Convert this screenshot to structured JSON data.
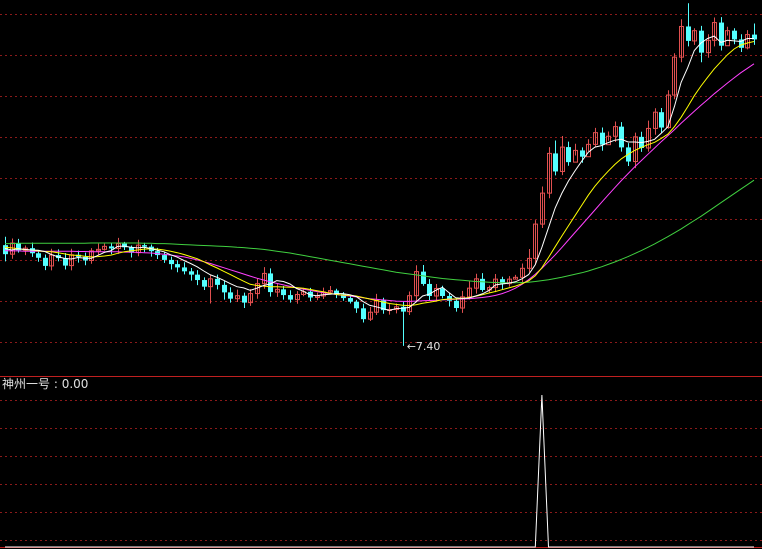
{
  "indicator": {
    "name": "神州一号",
    "separator": " : ",
    "value": "0.00"
  },
  "low_marker": "7.40",
  "colors": {
    "background": "#000000",
    "up": "#e05050",
    "down": "#54ffff",
    "ma_short": "#ffffff",
    "ma_mid": "#ffff00",
    "ma_long": "#ff40ff",
    "ma_longest": "#40d040",
    "grid": "#8b1a1a",
    "divider": "#c02020",
    "signal": "#ffffff"
  },
  "chart_data": {
    "type": "candlestick",
    "price_range": [
      6.4,
      18.9
    ],
    "signal_range": [
      0,
      1
    ],
    "candles": [
      [
        10.75,
        10.45,
        11.03,
        10.21
      ],
      [
        10.45,
        10.82,
        10.97,
        10.3
      ],
      [
        10.82,
        10.58,
        10.96,
        10.5
      ],
      [
        10.58,
        10.65,
        10.74,
        10.42
      ],
      [
        10.65,
        10.48,
        10.84,
        10.36
      ],
      [
        10.48,
        10.33,
        10.58,
        10.2
      ],
      [
        10.33,
        10.06,
        10.44,
        9.92
      ],
      [
        10.06,
        10.42,
        10.63,
        9.91
      ],
      [
        10.42,
        10.32,
        10.61,
        10.21
      ],
      [
        10.32,
        10.07,
        10.49,
        9.94
      ],
      [
        10.07,
        10.43,
        10.63,
        9.91
      ],
      [
        10.43,
        10.36,
        10.57,
        10.17
      ],
      [
        10.36,
        10.24,
        10.5,
        10.08
      ],
      [
        10.24,
        10.56,
        10.65,
        10.13
      ],
      [
        10.56,
        10.61,
        10.8,
        10.42
      ],
      [
        10.61,
        10.71,
        10.8,
        10.57
      ],
      [
        10.71,
        10.64,
        10.82,
        10.45
      ],
      [
        10.64,
        10.8,
        10.99,
        10.46
      ],
      [
        10.8,
        10.68,
        10.86,
        10.59
      ],
      [
        10.68,
        10.5,
        10.74,
        10.34
      ],
      [
        10.5,
        10.75,
        10.93,
        10.38
      ],
      [
        10.75,
        10.7,
        10.83,
        10.52
      ],
      [
        10.7,
        10.55,
        10.77,
        10.37
      ],
      [
        10.55,
        10.42,
        10.66,
        10.29
      ],
      [
        10.42,
        10.26,
        10.52,
        10.16
      ],
      [
        10.26,
        10.12,
        10.37,
        9.94
      ],
      [
        10.12,
        10.01,
        10.25,
        9.85
      ],
      [
        10.01,
        9.88,
        10.18,
        9.78
      ],
      [
        9.88,
        9.77,
        9.99,
        9.57
      ],
      [
        9.77,
        9.59,
        9.92,
        9.42
      ],
      [
        9.59,
        9.37,
        9.68,
        9.26
      ],
      [
        9.37,
        9.63,
        9.74,
        8.81
      ],
      [
        9.63,
        9.43,
        9.77,
        9.28
      ],
      [
        9.43,
        9.18,
        9.57,
        8.94
      ],
      [
        9.18,
        8.97,
        9.35,
        8.84
      ],
      [
        8.97,
        9.07,
        9.27,
        8.86
      ],
      [
        9.07,
        8.84,
        9.17,
        8.66
      ],
      [
        8.84,
        9.14,
        9.29,
        8.73
      ],
      [
        9.14,
        9.47,
        9.66,
        8.97
      ],
      [
        9.47,
        9.81,
        10.02,
        9.3
      ],
      [
        9.81,
        9.19,
        9.98,
        9.04
      ],
      [
        9.19,
        9.28,
        9.48,
        9.03
      ],
      [
        9.28,
        9.09,
        9.39,
        8.94
      ],
      [
        9.09,
        8.94,
        9.25,
        8.84
      ],
      [
        8.94,
        9.11,
        9.22,
        8.8
      ],
      [
        9.11,
        9.2,
        9.33,
        9.05
      ],
      [
        9.2,
        9.01,
        9.33,
        8.89
      ],
      [
        9.01,
        9.06,
        9.17,
        8.92
      ],
      [
        9.06,
        9.19,
        9.34,
        8.96
      ],
      [
        9.19,
        9.24,
        9.39,
        9.14
      ],
      [
        9.24,
        9.12,
        9.3,
        8.99
      ],
      [
        9.12,
        8.99,
        9.19,
        8.9
      ],
      [
        8.99,
        8.87,
        9.11,
        8.81
      ],
      [
        8.87,
        8.65,
        8.93,
        8.5
      ],
      [
        8.65,
        8.29,
        8.8,
        8.18
      ],
      [
        8.29,
        8.52,
        8.7,
        8.23
      ],
      [
        8.52,
        8.91,
        9.13,
        8.43
      ],
      [
        8.91,
        8.59,
        9.0,
        8.47
      ],
      [
        8.59,
        8.61,
        8.79,
        8.44
      ],
      [
        8.61,
        8.7,
        8.81,
        8.48
      ],
      [
        8.7,
        8.54,
        8.87,
        7.4
      ],
      [
        8.54,
        9.07,
        9.21,
        8.43
      ],
      [
        9.07,
        9.87,
        10.08,
        8.85
      ],
      [
        9.87,
        9.46,
        10.09,
        9.4
      ],
      [
        9.46,
        9.06,
        9.62,
        8.92
      ],
      [
        9.06,
        9.31,
        9.46,
        8.91
      ],
      [
        9.31,
        9.06,
        9.4,
        8.98
      ],
      [
        9.06,
        8.9,
        9.17,
        8.71
      ],
      [
        8.9,
        8.66,
        8.99,
        8.54
      ],
      [
        8.66,
        9.03,
        9.23,
        8.5
      ],
      [
        9.03,
        9.32,
        9.54,
        8.94
      ],
      [
        9.32,
        9.63,
        9.8,
        9.14
      ],
      [
        9.63,
        9.26,
        9.82,
        9.2
      ],
      [
        9.26,
        9.34,
        9.41,
        9.16
      ],
      [
        9.34,
        9.62,
        9.79,
        9.19
      ],
      [
        9.62,
        9.47,
        9.7,
        9.28
      ],
      [
        9.47,
        9.62,
        9.72,
        9.37
      ],
      [
        9.62,
        9.68,
        9.76,
        9.61
      ],
      [
        9.68,
        9.98,
        10.14,
        9.51
      ],
      [
        9.98,
        10.31,
        10.62,
        9.84
      ],
      [
        10.31,
        11.45,
        11.58,
        10.12
      ],
      [
        11.45,
        12.48,
        12.7,
        11.32
      ],
      [
        12.48,
        13.8,
        14.01,
        12.31
      ],
      [
        13.8,
        13.2,
        14.23,
        13.07
      ],
      [
        13.2,
        14.01,
        14.38,
        13.08
      ],
      [
        14.01,
        13.51,
        14.19,
        13.39
      ],
      [
        13.51,
        13.9,
        14.12,
        13.73
      ],
      [
        13.9,
        13.69,
        14.0,
        13.49
      ],
      [
        13.69,
        14.1,
        14.27,
        13.87
      ],
      [
        14.1,
        14.49,
        14.65,
        14.02
      ],
      [
        14.49,
        14.09,
        14.66,
        13.89
      ],
      [
        14.09,
        14.37,
        14.53,
        14.22
      ],
      [
        14.37,
        14.69,
        14.86,
        14.18
      ],
      [
        14.69,
        14.0,
        14.84,
        13.86
      ],
      [
        14.0,
        13.53,
        14.14,
        13.38
      ],
      [
        13.53,
        14.35,
        14.49,
        13.31
      ],
      [
        14.35,
        13.98,
        14.52,
        13.85
      ],
      [
        13.98,
        14.63,
        14.89,
        13.86
      ],
      [
        14.63,
        15.17,
        15.3,
        14.42
      ],
      [
        15.17,
        14.66,
        15.31,
        14.48
      ],
      [
        14.66,
        15.74,
        15.9,
        14.62
      ],
      [
        15.74,
        17.0,
        17.13,
        15.6
      ],
      [
        17.0,
        18.02,
        18.26,
        16.83
      ],
      [
        18.02,
        17.54,
        18.79,
        17.36
      ],
      [
        17.54,
        17.88,
        17.96,
        17.41
      ],
      [
        17.88,
        17.15,
        18.04,
        16.83
      ],
      [
        17.15,
        17.56,
        17.76,
        16.98
      ],
      [
        17.56,
        18.15,
        18.32,
        17.36
      ],
      [
        18.15,
        17.38,
        18.33,
        17.22
      ],
      [
        17.38,
        17.88,
        18.01,
        17.72
      ],
      [
        17.88,
        17.59,
        17.96,
        17.43
      ],
      [
        17.59,
        17.31,
        17.76,
        17.17
      ],
      [
        17.31,
        17.75,
        17.9,
        17.26
      ],
      [
        17.75,
        17.59,
        18.12,
        17.41
      ]
    ],
    "ma_short": [
      10.64,
      10.59,
      10.63,
      10.61,
      10.59,
      10.58,
      10.54,
      10.44,
      10.36,
      10.31,
      10.29,
      10.34,
      10.32,
      10.31,
      10.41,
      10.51,
      10.57,
      10.71,
      10.72,
      10.68,
      10.66,
      10.68,
      10.64,
      10.58,
      10.53,
      10.43,
      10.35,
      10.24,
      10.14,
      10.03,
      9.89,
      9.76,
      9.68,
      9.58,
      9.47,
      9.37,
      9.33,
      9.25,
      9.32,
      9.41,
      9.46,
      9.57,
      9.54,
      9.46,
      9.31,
      9.22,
      9.1,
      9.07,
      9.1,
      9.12,
      9.14,
      9.14,
      9.1,
      9.04,
      8.88,
      8.75,
      8.7,
      8.64,
      8.58,
      8.64,
      8.65,
      8.68,
      8.86,
      9.06,
      9.12,
      9.25,
      9.35,
      9.17,
      9.0,
      8.98,
      8.99,
      9.06,
      9.13,
      9.24,
      9.43,
      9.46,
      9.49,
      9.53,
      9.63,
      9.77,
      10.1,
      10.68,
      11.33,
      11.99,
      12.47,
      12.88,
      13.22,
      13.54,
      13.84,
      14.01,
      14.06,
      14.16,
      14.24,
      14.27,
      14.18,
      14.18,
      14.16,
      14.2,
      14.27,
      14.47,
      14.68,
      15.37,
      16.16,
      16.65,
      17.22,
      17.47,
      17.62,
      17.7,
      17.49,
      17.56,
      17.54,
      17.52,
      17.62,
      17.62
    ],
    "ma_mid": [
      10.68,
      10.66,
      10.63,
      10.6,
      10.59,
      10.56,
      10.54,
      10.53,
      10.5,
      10.46,
      10.42,
      10.41,
      10.38,
      10.36,
      10.37,
      10.39,
      10.42,
      10.48,
      10.53,
      10.56,
      10.59,
      10.62,
      10.63,
      10.62,
      10.59,
      10.55,
      10.5,
      10.44,
      10.37,
      10.3,
      10.2,
      10.09,
      9.99,
      9.88,
      9.77,
      9.66,
      9.55,
      9.45,
      9.41,
      9.39,
      9.37,
      9.37,
      9.36,
      9.35,
      9.34,
      9.32,
      9.28,
      9.24,
      9.2,
      9.15,
      9.11,
      9.09,
      9.08,
      9.06,
      9.01,
      8.96,
      8.91,
      8.86,
      8.81,
      8.78,
      8.75,
      8.74,
      8.77,
      8.82,
      8.85,
      8.89,
      8.94,
      8.96,
      8.96,
      8.98,
      9.01,
      9.05,
      9.1,
      9.16,
      9.21,
      9.27,
      9.33,
      9.39,
      9.47,
      9.56,
      9.73,
      10.0,
      10.34,
      10.7,
      11.05,
      11.39,
      11.73,
      12.07,
      12.41,
      12.71,
      12.97,
      13.21,
      13.43,
      13.62,
      13.77,
      13.9,
      14.0,
      14.09,
      14.17,
      14.3,
      14.44,
      14.69,
      15.0,
      15.35,
      15.72,
      16.04,
      16.33,
      16.61,
      16.85,
      17.08,
      17.27,
      17.4,
      17.47,
      17.52
    ],
    "ma_long": [
      10.57,
      10.56,
      10.56,
      10.55,
      10.55,
      10.55,
      10.55,
      10.55,
      10.55,
      10.55,
      10.55,
      10.54,
      10.54,
      10.53,
      10.53,
      10.53,
      10.53,
      10.53,
      10.52,
      10.52,
      10.51,
      10.5,
      10.49,
      10.47,
      10.45,
      10.42,
      10.39,
      10.36,
      10.31,
      10.26,
      10.2,
      10.14,
      10.07,
      10.0,
      9.93,
      9.86,
      9.79,
      9.72,
      9.65,
      9.59,
      9.53,
      9.48,
      9.43,
      9.38,
      9.33,
      9.29,
      9.25,
      9.21,
      9.17,
      9.14,
      9.11,
      9.08,
      9.06,
      9.03,
      9.0,
      8.97,
      8.95,
      8.93,
      8.91,
      8.89,
      8.88,
      8.88,
      8.89,
      8.9,
      8.91,
      8.92,
      8.93,
      8.94,
      8.95,
      8.96,
      8.97,
      8.99,
      9.01,
      9.04,
      9.08,
      9.14,
      9.22,
      9.32,
      9.45,
      9.6,
      9.78,
      9.98,
      10.2,
      10.43,
      10.67,
      10.92,
      11.17,
      11.42,
      11.67,
      11.92,
      12.17,
      12.42,
      12.66,
      12.9,
      13.13,
      13.35,
      13.56,
      13.77,
      13.98,
      14.19,
      14.39,
      14.59,
      14.8,
      15.0,
      15.2,
      15.4,
      15.59,
      15.78,
      15.96,
      16.14,
      16.31,
      16.48,
      16.63,
      16.78
    ],
    "ma_longest": [
      10.8,
      10.8,
      10.81,
      10.81,
      10.81,
      10.81,
      10.81,
      10.81,
      10.81,
      10.81,
      10.81,
      10.81,
      10.81,
      10.82,
      10.82,
      10.82,
      10.82,
      10.82,
      10.82,
      10.82,
      10.82,
      10.81,
      10.81,
      10.8,
      10.8,
      10.79,
      10.78,
      10.77,
      10.76,
      10.75,
      10.74,
      10.73,
      10.72,
      10.71,
      10.7,
      10.68,
      10.67,
      10.65,
      10.63,
      10.61,
      10.58,
      10.55,
      10.52,
      10.49,
      10.45,
      10.41,
      10.37,
      10.33,
      10.29,
      10.25,
      10.21,
      10.17,
      10.13,
      10.09,
      10.05,
      10.01,
      9.97,
      9.93,
      9.89,
      9.85,
      9.82,
      9.79,
      9.76,
      9.73,
      9.7,
      9.67,
      9.64,
      9.62,
      9.6,
      9.58,
      9.56,
      9.54,
      9.53,
      9.52,
      9.51,
      9.5,
      9.5,
      9.5,
      9.51,
      9.52,
      9.54,
      9.57,
      9.6,
      9.64,
      9.68,
      9.73,
      9.78,
      9.83,
      9.89,
      9.96,
      10.03,
      10.11,
      10.19,
      10.28,
      10.37,
      10.47,
      10.57,
      10.68,
      10.79,
      10.91,
      11.03,
      11.16,
      11.29,
      11.43,
      11.57,
      11.71,
      11.86,
      12.01,
      12.16,
      12.31,
      12.46,
      12.61,
      12.76,
      12.91
    ],
    "signal": [
      0,
      0,
      0,
      0,
      0,
      0,
      0,
      0,
      0,
      0,
      0,
      0,
      0,
      0,
      0,
      0,
      0,
      0,
      0,
      0,
      0,
      0,
      0,
      0,
      0,
      0,
      0,
      0,
      0,
      0,
      0,
      0,
      0,
      0,
      0,
      0,
      0,
      0,
      0,
      0,
      0,
      0,
      0,
      0,
      0,
      0,
      0,
      0,
      0,
      0,
      0,
      0,
      0,
      0,
      0,
      0,
      0,
      0,
      0,
      0,
      0,
      0,
      0,
      0,
      0,
      0,
      0,
      0,
      0,
      0,
      0,
      0,
      0,
      0,
      0,
      0,
      0,
      0,
      0,
      0,
      0,
      1,
      0,
      0,
      0,
      0,
      0,
      0,
      0,
      0,
      0,
      0,
      0,
      0,
      0,
      0,
      0,
      0,
      0,
      0,
      0,
      0,
      0,
      0,
      0,
      0,
      0,
      0,
      0,
      0,
      0,
      0,
      0,
      0
    ]
  }
}
